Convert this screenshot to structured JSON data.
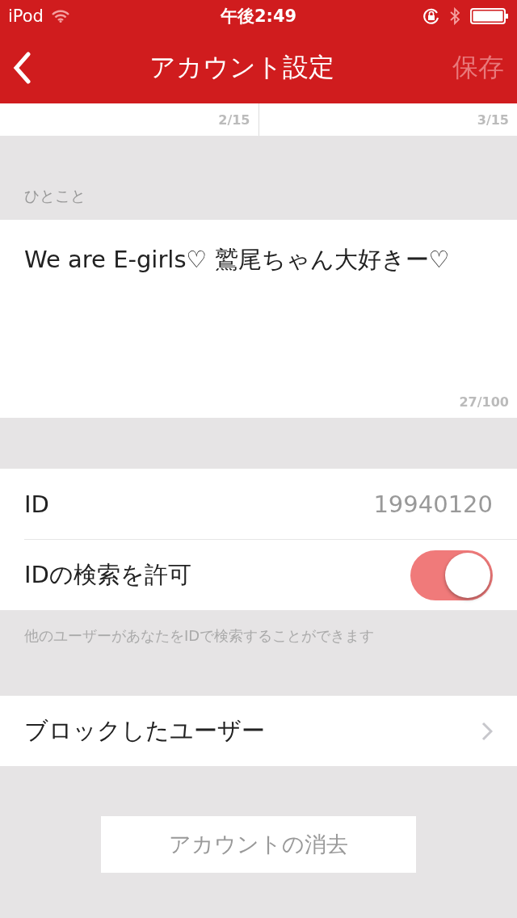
{
  "status_bar": {
    "carrier": "iPod",
    "time": "午後2:49"
  },
  "nav": {
    "title": "アカウント設定",
    "save": {
      "label": "保存",
      "disabled": true
    }
  },
  "name_fields": [
    {
      "counter": "2/15"
    },
    {
      "counter": "3/15"
    }
  ],
  "bio": {
    "label": "ひとこと",
    "value": "We are E-girls♡  鷲尾ちゃん大好きー♡",
    "counter": "27/100"
  },
  "id_row": {
    "label": "ID",
    "value": "19940120"
  },
  "search_toggle": {
    "label": "IDの検索を許可",
    "on": true,
    "hint": "他のユーザーがあなたをIDで検索することができます"
  },
  "blocked": {
    "label": "ブロックしたユーザー"
  },
  "delete_button": "アカウントの消去"
}
